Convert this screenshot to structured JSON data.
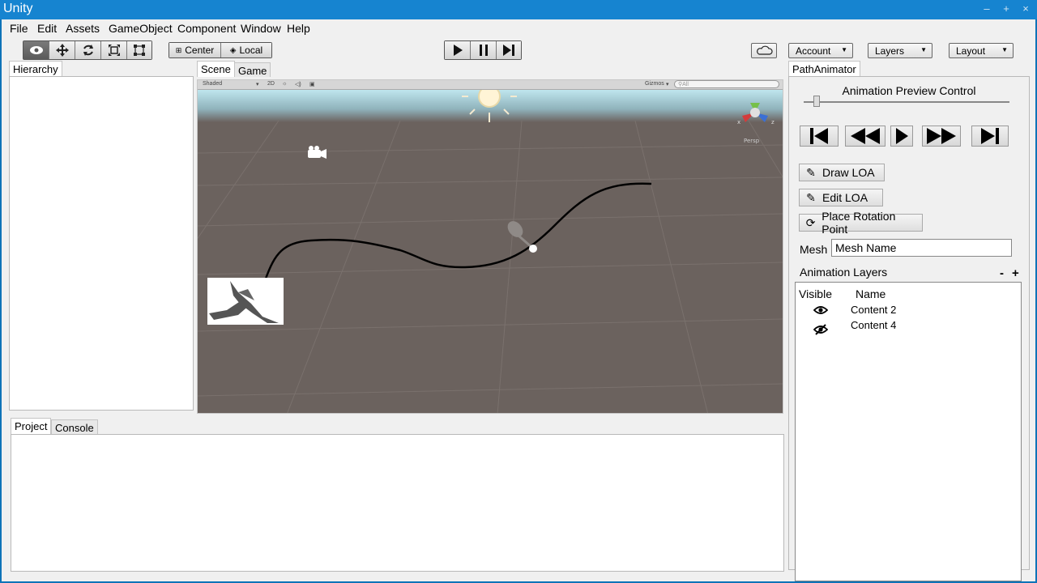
{
  "window": {
    "title": "Unity",
    "controls": [
      "–",
      "+",
      "×"
    ]
  },
  "menu": [
    "File",
    "Edit",
    "Assets",
    "GameObject",
    "Component",
    "Window",
    "Help"
  ],
  "toolbar": {
    "pivot_label": "Center",
    "space_label": "Local",
    "account_label": "Account",
    "layers_label": "Layers",
    "layout_label": "Layout"
  },
  "tabs": {
    "hierarchy": "Hierarchy",
    "scene": "Scene",
    "game": "Game",
    "project": "Project",
    "console": "Console",
    "path_animator": "PathAnimator"
  },
  "scene_bar": {
    "shading": "Shaded",
    "mode2d": "2D",
    "gizmos": "Gizmos",
    "search_placeholder": "All"
  },
  "scene": {
    "persp_label": "Persp",
    "axis_x": "x",
    "axis_z": "z"
  },
  "path_animator": {
    "preview_title": "Animation Preview Control",
    "preview_slider_position": 0.05,
    "draw_loa": "Draw LOA",
    "edit_loa": "Edit LOA",
    "place_rotation": "Place Rotation Point",
    "mesh_label": "Mesh",
    "mesh_value": "Mesh Name",
    "layers_title": "Animation Layers",
    "remove_label": "-",
    "add_label": "+",
    "columns": {
      "visible": "Visible",
      "name": "Name"
    },
    "layers": [
      {
        "name": "Content 2",
        "visible": true
      },
      {
        "name": "Content 4",
        "visible": false
      }
    ]
  }
}
